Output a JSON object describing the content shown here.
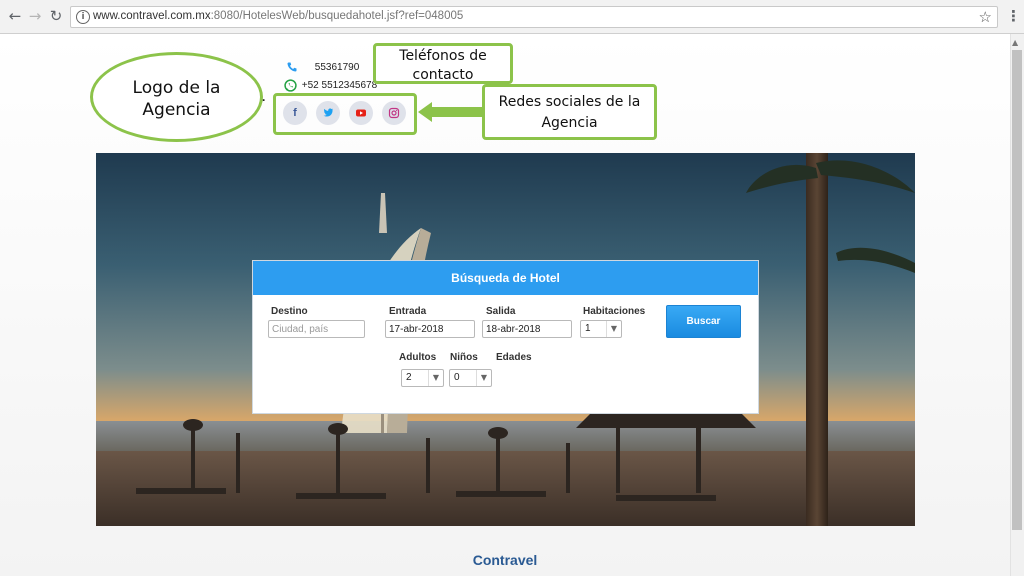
{
  "browser": {
    "url_host": "www.contravel.com.mx",
    "url_rest": ":8080/HotelesWeb/busquedahotel.jsf?ref=048005"
  },
  "header": {
    "phone": "55361790",
    "whatsapp": "+52 5512345678",
    "social": [
      {
        "name": "facebook",
        "glyph": "f",
        "color": "#3b5998"
      },
      {
        "name": "twitter",
        "glyph": "t",
        "color": "#1da1f2"
      },
      {
        "name": "youtube",
        "glyph": "▶",
        "color": "#e62117"
      },
      {
        "name": "instagram",
        "glyph": "◎",
        "color": "#c13584"
      }
    ]
  },
  "annotations": {
    "logo": "Logo de la Agencia",
    "phones": "Teléfonos de contacto",
    "social": "Redes sociales de la Agencia"
  },
  "search": {
    "title": "Búsqueda de Hotel",
    "destino_label": "Destino",
    "destino_placeholder": "Ciudad, país",
    "entrada_label": "Entrada",
    "entrada_value": "17-abr-2018",
    "salida_label": "Salida",
    "salida_value": "18-abr-2018",
    "habitaciones_label": "Habitaciones",
    "habitaciones_value": "1",
    "adultos_label": "Adultos",
    "adultos_value": "2",
    "ninos_label": "Niños",
    "ninos_value": "0",
    "edades_label": "Edades",
    "button_label": "Buscar"
  },
  "footer": {
    "brand": "Contravel"
  },
  "colors": {
    "accent": "#2d9df0",
    "callout_border": "#8cc34a",
    "brand_text": "#2a5a93"
  }
}
